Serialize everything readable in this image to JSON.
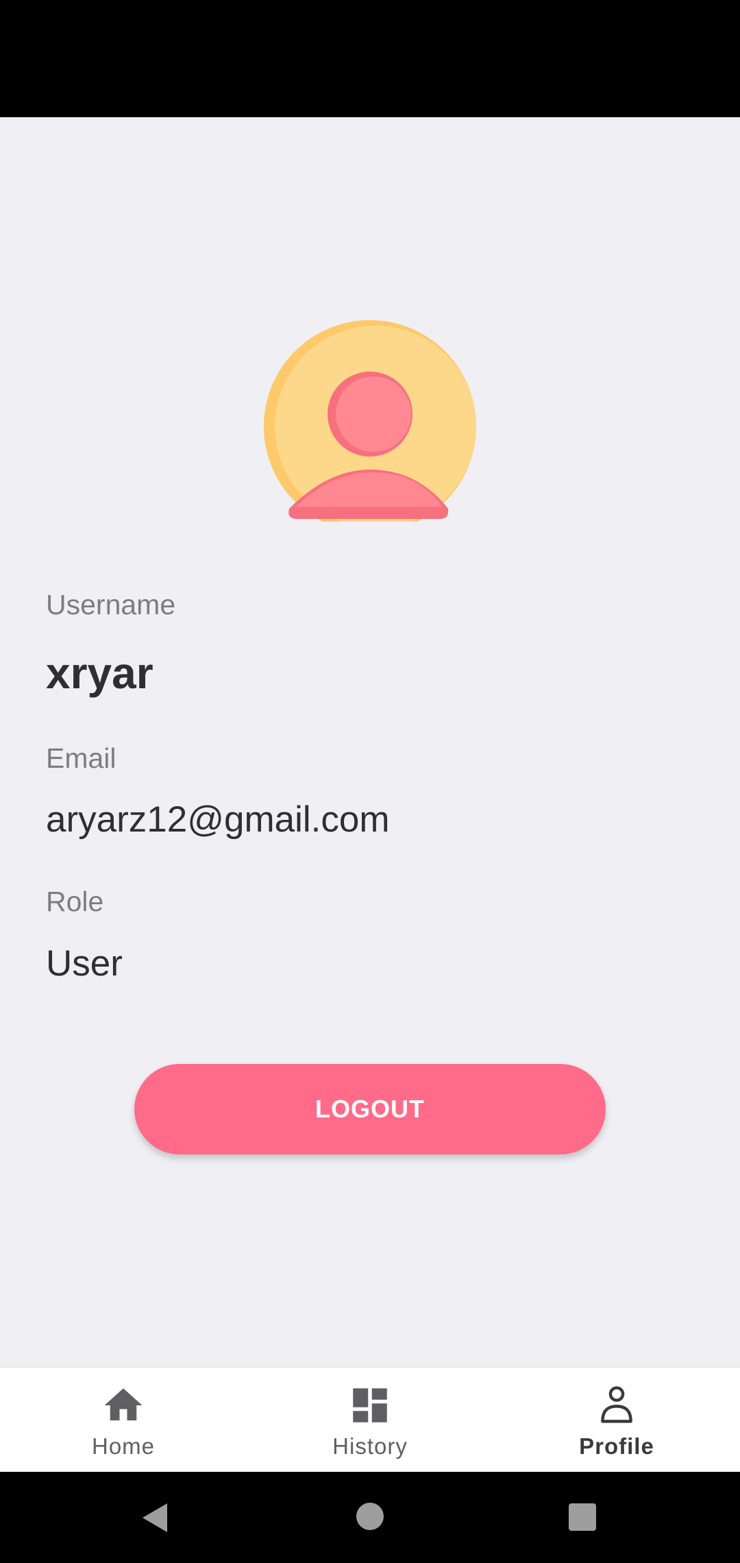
{
  "profile": {
    "username_label": "Username",
    "username": "xryar",
    "email_label": "Email",
    "email": "aryarz12@gmail.com",
    "role_label": "Role",
    "role": "User",
    "logout_label": "LOGOUT"
  },
  "bottom_nav": {
    "items": [
      {
        "label": "Home",
        "icon": "home-icon",
        "active": false
      },
      {
        "label": "History",
        "icon": "dashboard-icon",
        "active": false
      },
      {
        "label": "Profile",
        "icon": "person-icon",
        "active": true
      }
    ]
  },
  "system_nav": {
    "icons": [
      "back-icon",
      "home-circle-icon",
      "recents-icon"
    ]
  },
  "colors": {
    "background": "#f0eff4",
    "accent": "#ff6b89",
    "avatar_circle": "#fdd88a",
    "avatar_person": "#ff8893",
    "nav_background": "#ffffff"
  }
}
